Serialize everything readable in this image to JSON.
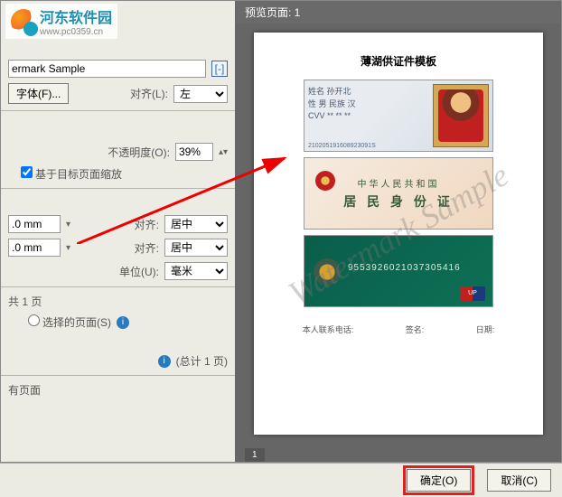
{
  "logo": {
    "name": "河东软件园",
    "url": "www.pc0359.cn"
  },
  "preview": {
    "header": "预览页面:  1",
    "page_num": "1"
  },
  "doc": {
    "title": "薄湖供证件模板",
    "card1_num": "210205191608923091S",
    "card2_line1": "中华人民共和国",
    "card2_line2": "居 民 身 份 证",
    "card3_num": "9553926021037305416",
    "card3_up": "UP",
    "sig1": "本人联系电话:",
    "sig2": "签名:",
    "sig3": "日期:",
    "watermark": "Watermark Sample"
  },
  "panel": {
    "sample_text": "ermark Sample",
    "font_btn": "字体(F)...",
    "align_l": "对齐(L):",
    "align_l_val": "左",
    "opacity_l": "不透明度(O):",
    "opacity_val": "39%",
    "scale_chk": "基于目标页面缩放",
    "offset_val": ".0 mm",
    "align_v": "居中",
    "unit_l": "单位(U):",
    "unit_val": "毫米",
    "align_label": "对齐:",
    "pages_all": "共 1 页",
    "pages_sel": "选择的页面(S)",
    "pages_total": "(总计 1 页)",
    "bg_opt": "有页面"
  },
  "buttons": {
    "ok": "确定(O)",
    "cancel": "取消(C)"
  }
}
